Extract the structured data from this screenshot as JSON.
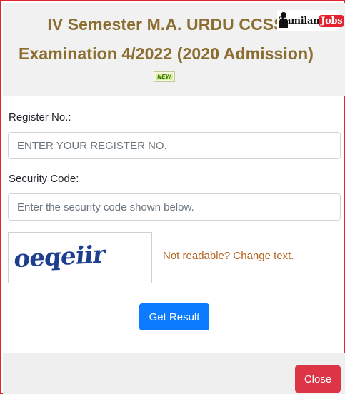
{
  "header": {
    "title_line1": "IV Semester M.A. URDU CCSS",
    "title_line2": "Examination 4/2022 (2020 Admission)",
    "new_badge": "NEW",
    "logo": {
      "word1": "Tamilan",
      "word2": "Jobs"
    }
  },
  "form": {
    "register": {
      "label": "Register No.:",
      "placeholder": "ENTER YOUR REGISTER NO.",
      "value": ""
    },
    "security": {
      "label": "Security Code:",
      "placeholder": "Enter the security code shown below.",
      "value": ""
    },
    "captcha": {
      "text": "oeqeiir",
      "change_link": "Not readable? Change text."
    },
    "submit_label": "Get Result"
  },
  "footer": {
    "close_label": "Close"
  },
  "colors": {
    "border": "#e3232d",
    "title": "#8a6d2f",
    "primary": "#0d7bff",
    "danger": "#dc3545",
    "link": "#b5651d"
  }
}
